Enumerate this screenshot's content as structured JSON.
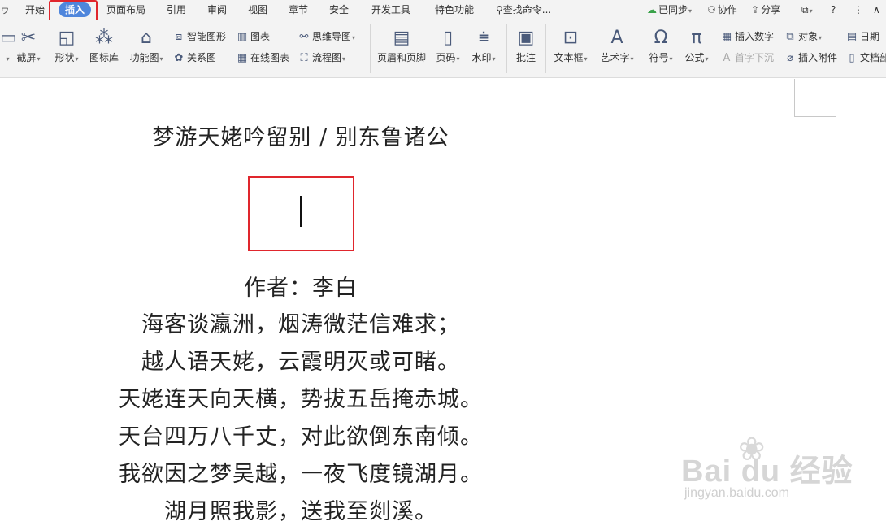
{
  "menu": {
    "items": [
      "开始",
      "插入",
      "页面布局",
      "引用",
      "审阅",
      "视图",
      "章节",
      "安全",
      "开发工具",
      "特色功能"
    ],
    "active": "插入",
    "search": "查找命令..."
  },
  "topright": {
    "sync": "已同步",
    "collab": "协作",
    "share": "分享",
    "help": "?",
    "more": "⋮"
  },
  "ribbon": {
    "big": {
      "screenshot": "截屏",
      "shape": "形状",
      "iconlib": "图标库",
      "funcmap": "功能图",
      "header_footer": "页眉和页脚",
      "page_number": "页码",
      "watermark": "水印",
      "comment": "批注",
      "textbox": "文本框",
      "wordart": "艺术字",
      "symbol": "符号",
      "formula": "公式"
    },
    "small": {
      "smart_shape": "智能图形",
      "chart": "图表",
      "mindmap": "思维导图",
      "relation": "关系图",
      "online_chart": "在线图表",
      "flowchart": "流程图",
      "insert_number": "插入数字",
      "object": "对象",
      "date": "日期",
      "drop_cap": "首字下沉",
      "attach": "插入附件",
      "docpart": "文档部"
    }
  },
  "document": {
    "title": "梦游天姥吟留别 / 别东鲁诸公",
    "author": "作者：李白",
    "lines": [
      "海客谈瀛洲，烟涛微茫信难求；",
      "越人语天姥，云霞明灭或可睹。",
      "天姥连天向天横，势拔五岳掩赤城。",
      "天台四万八千丈，对此欲倒东南倾。",
      "我欲因之梦吴越，一夜飞度镜湖月。",
      "湖月照我影，送我至剡溪。"
    ]
  },
  "watermark": {
    "brand": "Bai du 经验",
    "url": "jingyan.baidu.com"
  },
  "colors": {
    "active_tab": "#4f86dc",
    "highlight": "#e0262d",
    "ribbon_bg": "#f3f3f3"
  }
}
